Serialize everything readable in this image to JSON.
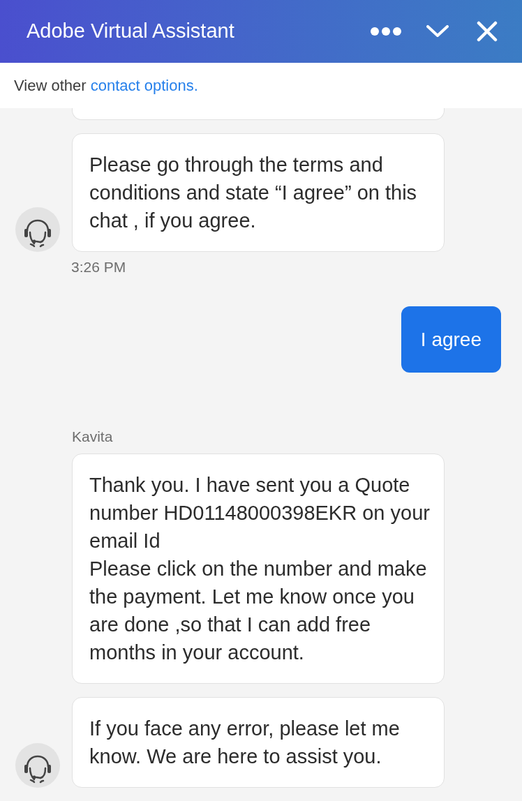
{
  "header": {
    "title": "Adobe Virtual Assistant"
  },
  "notice": {
    "text": "View other",
    "link": "contact options."
  },
  "messages": [
    {
      "kind": "partial"
    },
    {
      "kind": "agent",
      "avatar": true,
      "text": "Please go through the terms and conditions and state “I agree” on this chat , if you agree.",
      "time": "3:26 PM"
    },
    {
      "kind": "user",
      "text": "I agree"
    },
    {
      "kind": "sender",
      "name": "Kavita"
    },
    {
      "kind": "agent",
      "avatar": false,
      "text": "Thank you. I have sent you a Quote number HD01148000398EKR on your email Id\nPlease click on the number and make the payment. Let me know once you are done ,so that I can add free months in your account."
    },
    {
      "kind": "agent",
      "avatar": true,
      "text": "If you face any error, please let me know. We are here to assist you."
    }
  ]
}
